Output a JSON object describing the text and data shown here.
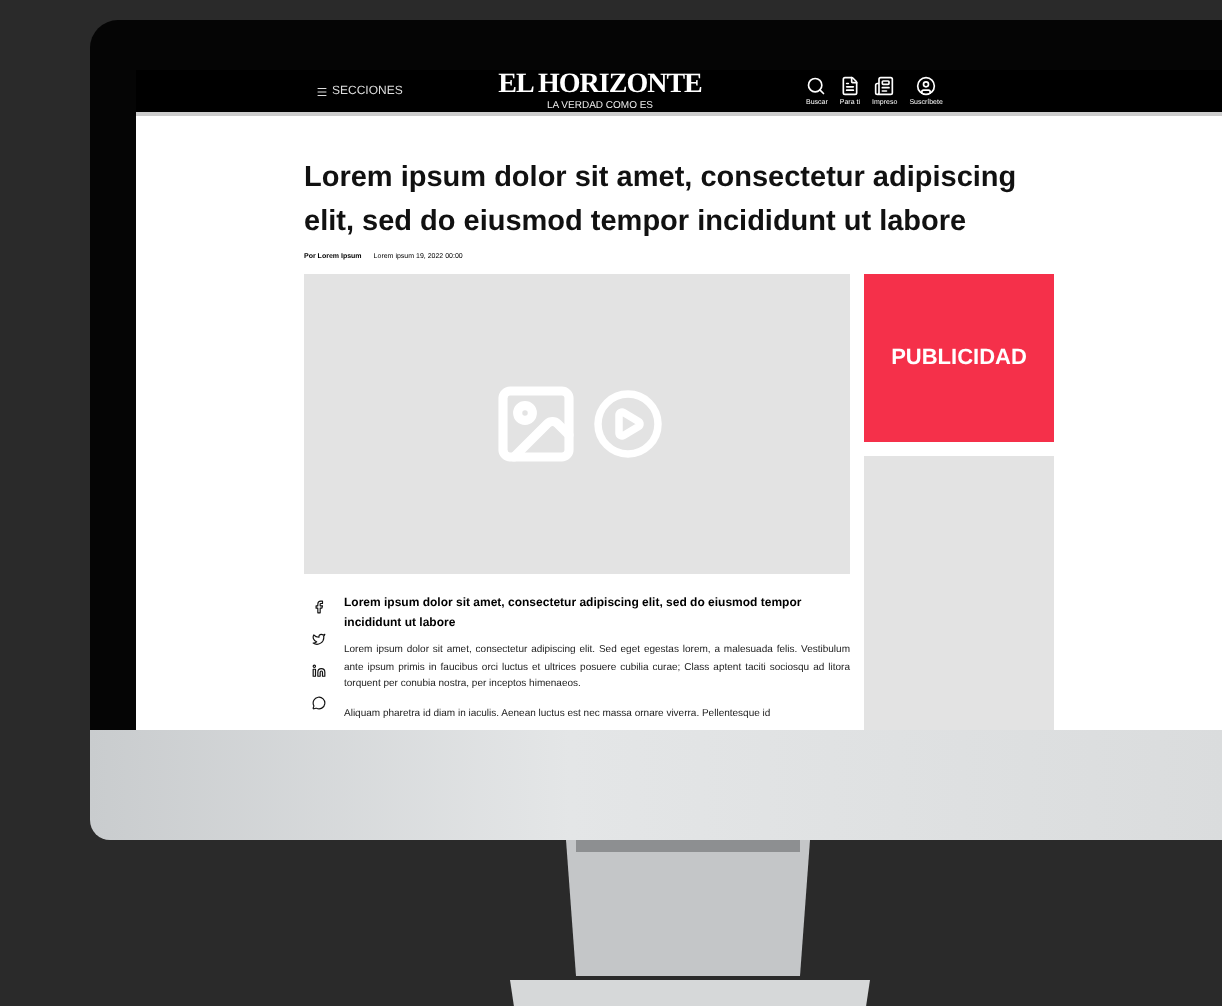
{
  "header": {
    "menu": "SECCIONES",
    "logo": "EL HORIZONTE",
    "tagline": "LA VERDAD COMO ES",
    "actions": [
      {
        "kind": "search",
        "label": "Buscar"
      },
      {
        "kind": "foryou",
        "label": "Para ti"
      },
      {
        "kind": "print",
        "label": "Impreso"
      },
      {
        "kind": "subscribe",
        "label": "Suscríbete"
      }
    ]
  },
  "article": {
    "headline": "Lorem ipsum dolor sit amet, consectetur adipiscing elit, sed do eiusmod tempor incididunt ut labore",
    "author": "Por Lorem Ipsum",
    "date": "Lorem ipsum 19, 2022 00:00",
    "share": [
      {
        "kind": "facebook"
      },
      {
        "kind": "twitter"
      },
      {
        "kind": "linkedin"
      },
      {
        "kind": "whatsapp"
      }
    ],
    "subheading": "Lorem ipsum dolor sit amet, consectetur adipiscing elit, sed do eiusmod tempor incididunt ut labore",
    "paragraphs": [
      "Lorem ipsum dolor sit amet, consectetur adipiscing elit. Sed eget egestas lorem, a malesuada felis. Vestibulum ante ipsum primis in faucibus orci luctus et ultrices posuere cubilia curae; Class aptent taciti sociosqu ad litora torquent per conubia nostra, per inceptos himenaeos.",
      "Aliquam pharetra id diam in iaculis. Aenean luctus est nec massa ornare viverra. Pellentesque id"
    ]
  },
  "sidebar": {
    "ad": "PUBLICIDAD"
  }
}
